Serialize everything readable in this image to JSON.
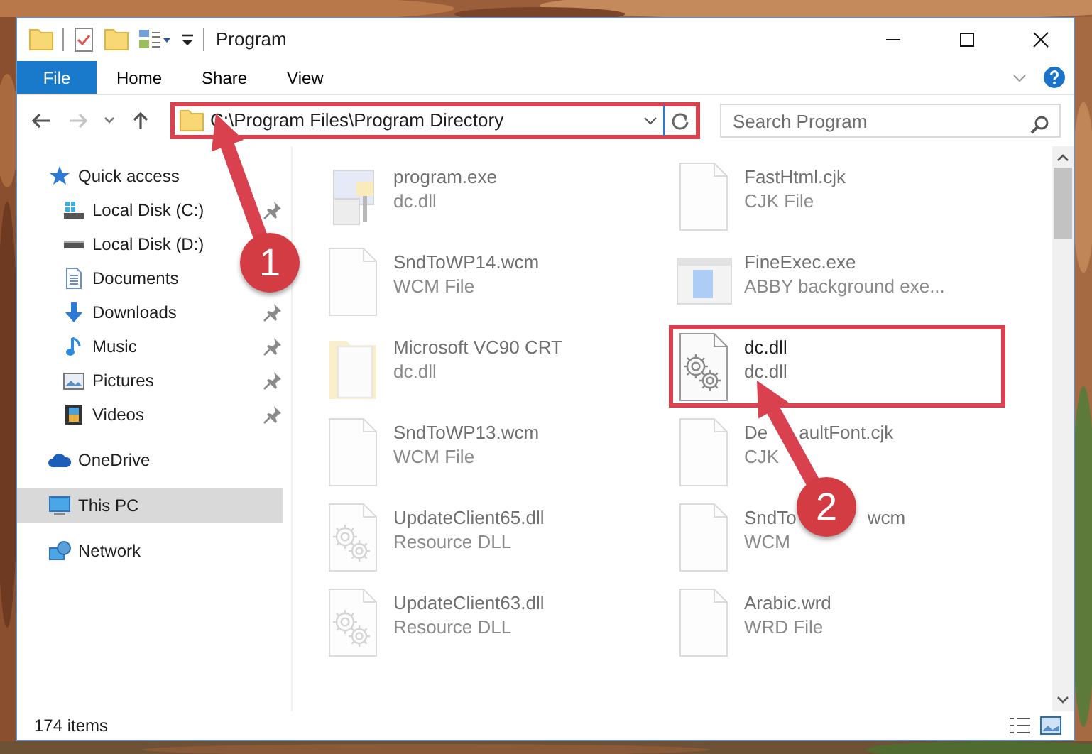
{
  "window": {
    "title": "Program"
  },
  "ribbon": {
    "tabs": [
      {
        "label": "File",
        "kind": "file",
        "selected": false
      },
      {
        "label": "Home",
        "kind": "tab",
        "selected": false
      },
      {
        "label": "Share",
        "kind": "tab",
        "selected": false
      },
      {
        "label": "View",
        "kind": "tab",
        "selected": false
      }
    ]
  },
  "address": {
    "path": "C:\\Program Files\\Program Directory",
    "annotated": true
  },
  "search": {
    "placeholder": "Search Program"
  },
  "nav": [
    {
      "label": "Quick access",
      "kind": "star",
      "selected": false,
      "children": [
        {
          "label": "Local Disk (C:)",
          "kind": "drive-win",
          "selected": false,
          "pinned": true
        },
        {
          "label": "Local Disk (D:)",
          "kind": "drive",
          "selected": false
        },
        {
          "label": "Documents",
          "kind": "document",
          "selected": false
        },
        {
          "label": "Downloads",
          "kind": "download",
          "selected": false,
          "pinned": true
        },
        {
          "label": "Music",
          "kind": "music",
          "selected": false,
          "pinned": true
        },
        {
          "label": "Pictures",
          "kind": "picture",
          "selected": false,
          "pinned": true
        },
        {
          "label": "Videos",
          "kind": "video",
          "selected": false,
          "pinned": true
        }
      ]
    },
    {
      "label": "OneDrive",
      "kind": "cloud",
      "selected": false
    },
    {
      "label": "This PC",
      "kind": "computer",
      "selected": true
    },
    {
      "label": "Network",
      "kind": "network",
      "selected": false
    }
  ],
  "files": [
    {
      "name": "program.exe",
      "type": "dc.dll",
      "kind": "installer",
      "faded": true,
      "annotated": false
    },
    {
      "name": "FastHtml.cjk",
      "type": "CJK File",
      "kind": "blank",
      "faded": true,
      "annotated": false
    },
    {
      "name": "SndToWP14.wcm",
      "type": "WCM File",
      "kind": "blank",
      "faded": true,
      "annotated": false
    },
    {
      "name": "FineExec.exe",
      "type": "ABBY background exe...",
      "kind": "app",
      "faded": true,
      "annotated": false
    },
    {
      "name": "Microsoft VC90 CRT",
      "type": "dc.dll",
      "kind": "folder",
      "faded": true,
      "annotated": false
    },
    {
      "name": "dc.dll",
      "type": "dc.dll",
      "kind": "gear",
      "faded": false,
      "annotated": true
    },
    {
      "name": "SndToWP13.wcm",
      "type": "WCM File",
      "kind": "blank",
      "faded": true,
      "annotated": false
    },
    {
      "name_parts": [
        "De",
        "aultFont.cjk"
      ],
      "type": "CJK",
      "kind": "blank",
      "faded": true,
      "annotated": false
    },
    {
      "name": "UpdateClient65.dll",
      "type": "Resource DLL",
      "kind": "gear",
      "faded": true,
      "annotated": false
    },
    {
      "name_parts": [
        "SndTo",
        "wcm"
      ],
      "type": "WCM",
      "kind": "blank",
      "faded": true,
      "annotated": false
    },
    {
      "name": "UpdateClient63.dll",
      "type": "Resource DLL",
      "kind": "gear",
      "faded": true,
      "annotated": false
    },
    {
      "name": "Arabic.wrd",
      "type": "WRD File",
      "kind": "blank",
      "faded": true,
      "annotated": false
    }
  ],
  "status_bar": {
    "item_count": "174 items"
  },
  "annotations": [
    {
      "label": "1"
    },
    {
      "label": "2"
    }
  ]
}
